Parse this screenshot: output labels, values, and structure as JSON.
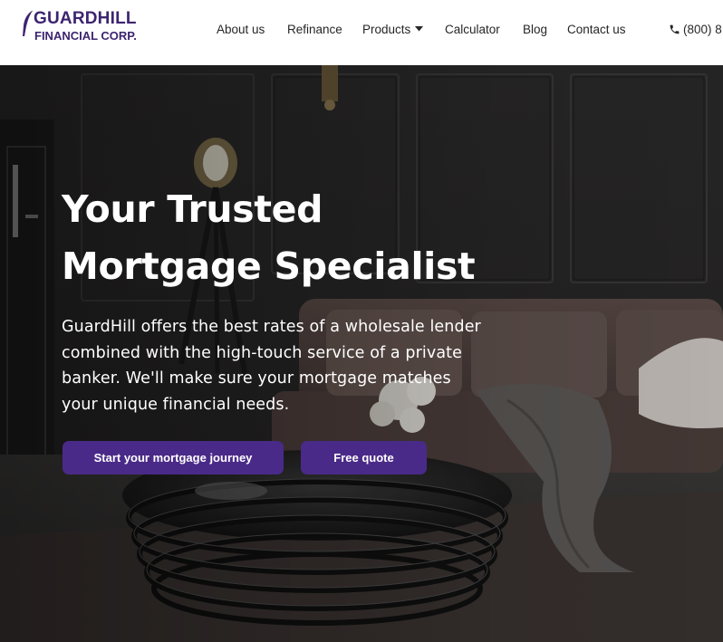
{
  "brand": {
    "name_line1": "GUARDHILL",
    "name_line2": "FINANCIAL CORP.",
    "color": "#3d2470"
  },
  "nav": {
    "items": [
      {
        "label": "About us"
      },
      {
        "label": "Refinance"
      },
      {
        "label": "Products",
        "has_dropdown": true
      },
      {
        "label": "Calculator"
      },
      {
        "label": "Blog"
      },
      {
        "label": "Contact us"
      }
    ],
    "phone_label": "(800) 8",
    "phone_icon": "phone-icon",
    "dropdown_icon": "caret-down-icon"
  },
  "hero": {
    "title_line1": "Your Trusted",
    "title_line2": "Mortgage Specialist",
    "subtitle": "GuardHill offers the best rates of a wholesale lender combined with the high-touch service of a private banker. We'll make sure your mortgage matches your unique financial needs.",
    "primary_button": "Start your mortgage journey",
    "secondary_button": "Free quote",
    "button_color": "#4a2a88"
  }
}
